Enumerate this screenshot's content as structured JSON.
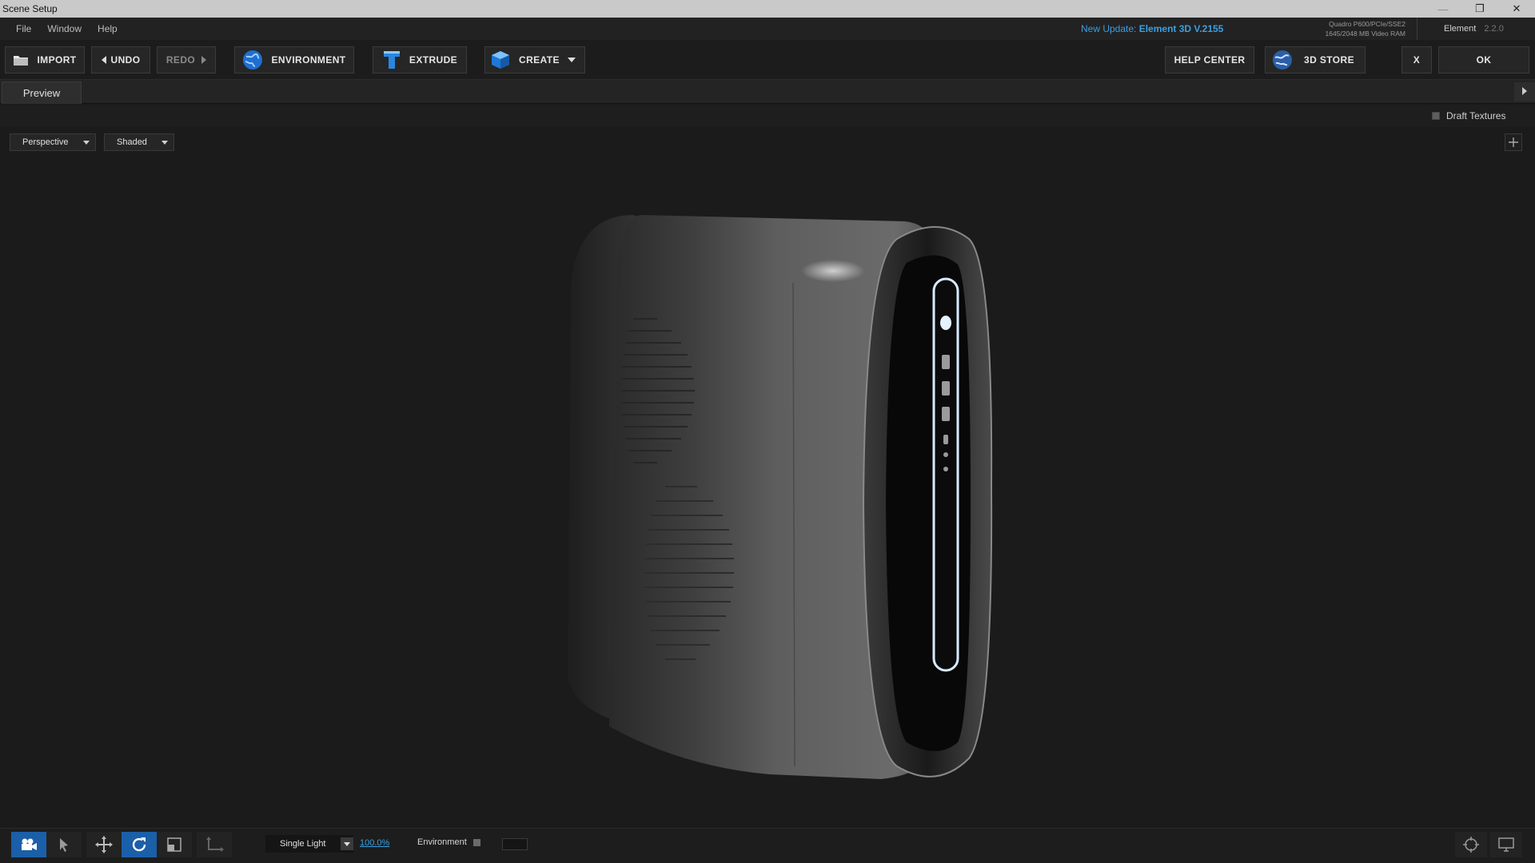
{
  "window": {
    "title": "Scene Setup"
  },
  "menu": {
    "items": [
      "File",
      "Window",
      "Help"
    ]
  },
  "update": {
    "prefix": "New Update:",
    "version": "Element 3D V.2155"
  },
  "gpu": {
    "name": "Quadro P600/PCIe/SSE2",
    "memory": "1645/2048 MB Video RAM"
  },
  "element": {
    "label": "Element",
    "version": "2.2.0"
  },
  "toolbar": {
    "import": "IMPORT",
    "undo": "UNDO",
    "redo": "REDO",
    "environment": "ENVIRONMENT",
    "extrude": "EXTRUDE",
    "create": "CREATE",
    "help_center": "HELP CENTER",
    "store": "3D STORE",
    "close": "X",
    "ok": "OK"
  },
  "tabs": {
    "preview": "Preview"
  },
  "viewport": {
    "draft_textures": "Draft Textures",
    "camera_mode": "Perspective",
    "shading_mode": "Shaded"
  },
  "bottom": {
    "light_mode": "Single Light",
    "light_percent": "100.0%",
    "environment": "Environment"
  },
  "colors": {
    "accent": "#3c9fe0",
    "active_tool": "#1b5fa8"
  }
}
